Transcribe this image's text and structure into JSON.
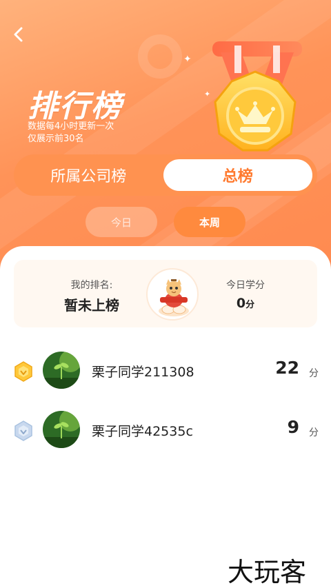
{
  "header": {
    "title": "排行榜",
    "subtitle_line1": "数据每4小时更新一次",
    "subtitle_line2": "仅展示前30名"
  },
  "tabs": [
    {
      "label": "所属公司榜",
      "active": false
    },
    {
      "label": "总榜",
      "active": true
    }
  ],
  "period_tabs": [
    {
      "label": "今日",
      "active": false
    },
    {
      "label": "本周",
      "active": true
    }
  ],
  "my_rank": {
    "rank_label": "我的排名:",
    "rank_value": "暂未上榜",
    "today_label": "今日学分",
    "today_value": "0",
    "today_unit": "分"
  },
  "ranking": [
    {
      "badge": "gold-rank-badge",
      "name": "栗子同学211308",
      "score": "22",
      "unit": "分"
    },
    {
      "badge": "silver-rank-badge",
      "name": "栗子同学42535c",
      "score": "9",
      "unit": "分"
    }
  ],
  "watermark_text": "大玩客",
  "colors": {
    "primary": "#ff8a50",
    "accent_text": "#ff7a2f",
    "card_bg": "#fff8f1",
    "gold": "#ffc83a",
    "silver": "#a9c2e0"
  }
}
